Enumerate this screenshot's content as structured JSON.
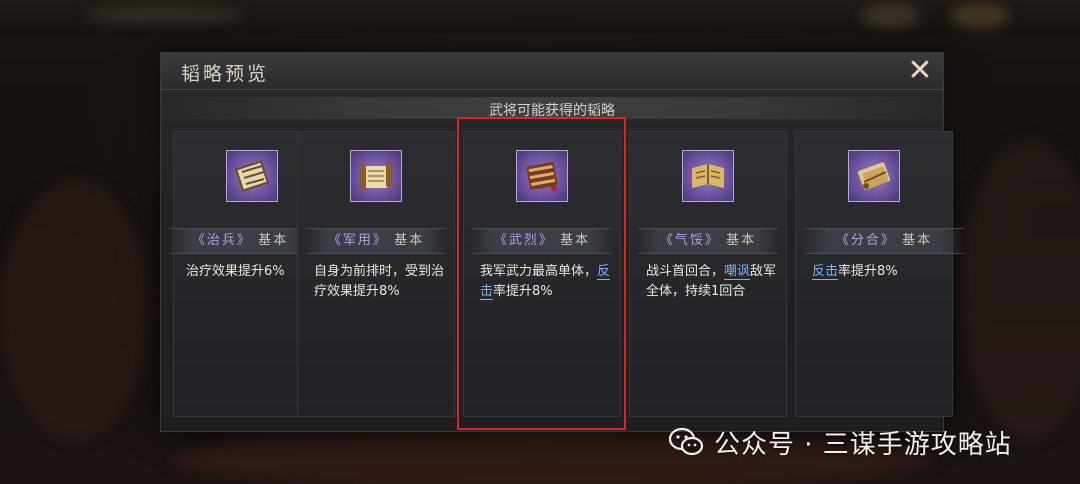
{
  "dialog": {
    "title": "韬略预览",
    "close_label": "✕",
    "subtitle": "武将可能获得的韬略"
  },
  "cards": [
    {
      "name": "治兵",
      "grade": "基本",
      "bracket_open": "《",
      "bracket_close": "》",
      "desc_text": "治疗效果提升6%",
      "icon": "tactic-book-icon"
    },
    {
      "name": "军用",
      "grade": "基本",
      "bracket_open": "《",
      "bracket_close": "》",
      "desc_text": "自身为前排时，受到治疗效果提升8%",
      "icon": "scroll-icon"
    },
    {
      "name": "武烈",
      "grade": "基本",
      "bracket_open": "《",
      "bracket_close": "》",
      "desc_pre": "我军武力最高单体，",
      "desc_keyword": "反击",
      "desc_post": "率提升8%",
      "icon": "book-icon",
      "highlighted": true
    },
    {
      "name": "气馁",
      "grade": "基本",
      "bracket_open": "《",
      "bracket_close": "》",
      "desc_pre": "战斗首回合，",
      "desc_keyword": "嘲讽",
      "desc_post": "敌军全体，持续1回合",
      "icon": "open-book-icon"
    },
    {
      "name": "分合",
      "grade": "基本",
      "bracket_open": "《",
      "bracket_close": "》",
      "desc_keyword": "反击",
      "desc_post": "率提升8%",
      "icon": "scroll-bundle-icon"
    }
  ],
  "watermark": {
    "text": "公众号 · 三谋手游攻略站",
    "icon": "wechat-icon"
  },
  "colors": {
    "accent_purple": "#b49ee8",
    "keyword_blue": "#7db3f2",
    "highlight_red": "#d8271f"
  }
}
